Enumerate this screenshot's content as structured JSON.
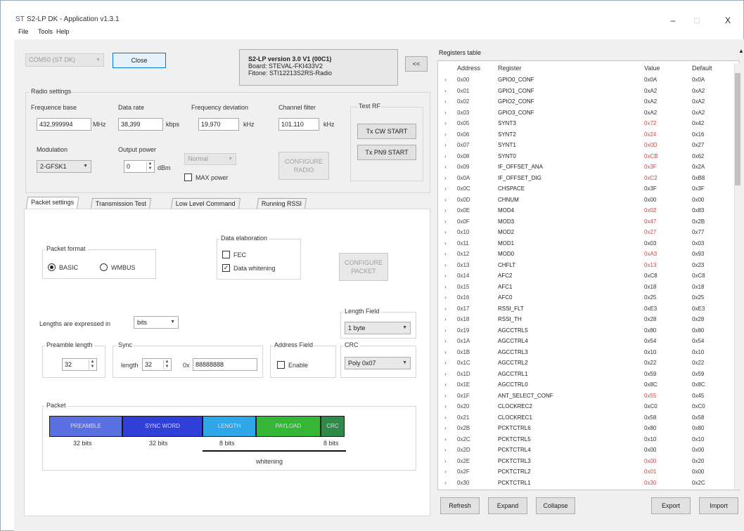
{
  "window": {
    "title": "S2-LP DK - Application v1.3.1",
    "controls": {
      "minimize": "–",
      "maximize": "□",
      "close": "X"
    }
  },
  "menu": {
    "file": "File",
    "tools": "Tools",
    "help": "Help"
  },
  "top": {
    "port_combo": "COM50 (ST DK)",
    "close_button": "Close",
    "device_info": {
      "line1": "S2-LP version 3.0 V1 (00C1)",
      "line2": "Board: STEVAL-FKI433V2",
      "line3": "Fitone: STI12213S2RS-Radio"
    },
    "collapse_button": "<<"
  },
  "radio_settings": {
    "group_title": "Radio settings",
    "frequency_base": {
      "label": "Frequence base",
      "value": "432,999994",
      "unit": "MHz"
    },
    "data_rate": {
      "label": "Data rate",
      "value": "38,399",
      "unit": "kbps"
    },
    "frequency_deviation": {
      "label": "Frequency deviation",
      "value": "19,970",
      "unit": "kHz"
    },
    "channel_filter": {
      "label": "Channel filter",
      "value": "101.110",
      "unit": "kHz"
    },
    "modulation": {
      "label": "Modulation",
      "value": "2-GFSK1"
    },
    "output_power": {
      "label": "Output power",
      "value": "0",
      "unit": "dBm"
    },
    "normal_combo": "Normal",
    "max_power_label": "MAX power",
    "configure_radio": "CONFIGURE RADIO",
    "test_rf": {
      "title": "Test RF",
      "tx_cw": "Tx CW START",
      "tx_pn9": "Tx PN9 START"
    }
  },
  "tabs": [
    {
      "label": "Packet settings"
    },
    {
      "label": "Transmission Test"
    },
    {
      "label": "Low Level Command"
    },
    {
      "label": "Running RSSI"
    }
  ],
  "packet_settings": {
    "packet_format": {
      "title": "Packet format",
      "basic": "BASIC",
      "wmbus": "WMBUS",
      "selected": "BASIC"
    },
    "data_elaboration": {
      "title": "Data elaboration",
      "fec": "FEC",
      "fec_checked": false,
      "whitening": "Data whitening",
      "whitening_checked": true
    },
    "configure_packet": "CONFIGURE PACKET",
    "lengths_label": "Lengths are expressed in",
    "lengths_unit": "bits",
    "length_field": {
      "title": "Length Field",
      "value": "1 byte"
    },
    "preamble": {
      "title": "Preamble length",
      "value": "32"
    },
    "sync": {
      "title": "Sync",
      "length_label": "length",
      "length_value": "32",
      "hex_prefix": "0x",
      "hex_value": "88888888"
    },
    "address_field": {
      "title": "Address Field",
      "enable": "Enable",
      "checked": false
    },
    "crc": {
      "title": "CRC",
      "value": "Poly 0x07"
    },
    "packet": {
      "title": "Packet",
      "segments": [
        {
          "label": "PREAMBLE",
          "bits": "32 bits",
          "color": "#5a6fe0"
        },
        {
          "label": "SYNC WORD",
          "bits": "32 bits",
          "color": "#2f3fd8"
        },
        {
          "label": "LENGTH",
          "bits": "8 bits",
          "color": "#2fa6e8"
        },
        {
          "label": "PAYLOAD",
          "bits": "",
          "color": "#36b636"
        },
        {
          "label": "CRC",
          "bits": "8 bits",
          "color": "#2f8a4a"
        }
      ],
      "whitening_label": "whitening"
    }
  },
  "registers": {
    "title": "Registers table",
    "headers": {
      "address": "Address",
      "register": "Register",
      "value": "Value",
      "default": "Default"
    },
    "rows": [
      {
        "addr": "0x00",
        "name": "GPIO0_CONF",
        "value": "0x0A",
        "default": "0x0A",
        "diff": false
      },
      {
        "addr": "0x01",
        "name": "GPIO1_CONF",
        "value": "0xA2",
        "default": "0xA2",
        "diff": false
      },
      {
        "addr": "0x02",
        "name": "GPIO2_CONF",
        "value": "0xA2",
        "default": "0xA2",
        "diff": false
      },
      {
        "addr": "0x03",
        "name": "GPIO3_CONF",
        "value": "0xA2",
        "default": "0xA2",
        "diff": false
      },
      {
        "addr": "0x05",
        "name": "SYNT3",
        "value": "0x72",
        "default": "0x42",
        "diff": true
      },
      {
        "addr": "0x06",
        "name": "SYNT2",
        "value": "0x24",
        "default": "0x16",
        "diff": true
      },
      {
        "addr": "0x07",
        "name": "SYNT1",
        "value": "0x0D",
        "default": "0x27",
        "diff": true
      },
      {
        "addr": "0x08",
        "name": "SYNT0",
        "value": "0xCB",
        "default": "0x62",
        "diff": true
      },
      {
        "addr": "0x09",
        "name": "IF_OFFSET_ANA",
        "value": "0x3F",
        "default": "0x2A",
        "diff": true
      },
      {
        "addr": "0x0A",
        "name": "IF_OFFSET_DIG",
        "value": "0xC2",
        "default": "0xB8",
        "diff": true
      },
      {
        "addr": "0x0C",
        "name": "CHSPACE",
        "value": "0x3F",
        "default": "0x3F",
        "diff": false
      },
      {
        "addr": "0x0D",
        "name": "CHNUM",
        "value": "0x00",
        "default": "0x00",
        "diff": false
      },
      {
        "addr": "0x0E",
        "name": "MOD4",
        "value": "0x02",
        "default": "0x83",
        "diff": true
      },
      {
        "addr": "0x0F",
        "name": "MOD3",
        "value": "0x47",
        "default": "0x2B",
        "diff": true
      },
      {
        "addr": "0x10",
        "name": "MOD2",
        "value": "0x27",
        "default": "0x77",
        "diff": true
      },
      {
        "addr": "0x11",
        "name": "MOD1",
        "value": "0x03",
        "default": "0x03",
        "diff": false
      },
      {
        "addr": "0x12",
        "name": "MOD0",
        "value": "0xA3",
        "default": "0x93",
        "diff": true
      },
      {
        "addr": "0x13",
        "name": "CHFLT",
        "value": "0x13",
        "default": "0x23",
        "diff": true
      },
      {
        "addr": "0x14",
        "name": "AFC2",
        "value": "0xC8",
        "default": "0xC8",
        "diff": false
      },
      {
        "addr": "0x15",
        "name": "AFC1",
        "value": "0x18",
        "default": "0x18",
        "diff": false
      },
      {
        "addr": "0x16",
        "name": "AFC0",
        "value": "0x25",
        "default": "0x25",
        "diff": false
      },
      {
        "addr": "0x17",
        "name": "RSSI_FLT",
        "value": "0xE3",
        "default": "0xE3",
        "diff": false
      },
      {
        "addr": "0x18",
        "name": "RSSI_TH",
        "value": "0x28",
        "default": "0x28",
        "diff": false
      },
      {
        "addr": "0x19",
        "name": "AGCCTRL5",
        "value": "0x80",
        "default": "0x80",
        "diff": false
      },
      {
        "addr": "0x1A",
        "name": "AGCCTRL4",
        "value": "0x54",
        "default": "0x54",
        "diff": false
      },
      {
        "addr": "0x1B",
        "name": "AGCCTRL3",
        "value": "0x10",
        "default": "0x10",
        "diff": false
      },
      {
        "addr": "0x1C",
        "name": "AGCCTRL2",
        "value": "0x22",
        "default": "0x22",
        "diff": false
      },
      {
        "addr": "0x1D",
        "name": "AGCCTRL1",
        "value": "0x59",
        "default": "0x59",
        "diff": false
      },
      {
        "addr": "0x1E",
        "name": "AGCCTRL0",
        "value": "0x8C",
        "default": "0x8C",
        "diff": false
      },
      {
        "addr": "0x1F",
        "name": "ANT_SELECT_CONF",
        "value": "0x55",
        "default": "0x45",
        "diff": true
      },
      {
        "addr": "0x20",
        "name": "CLOCKREC2",
        "value": "0xC0",
        "default": "0xC0",
        "diff": false
      },
      {
        "addr": "0x21",
        "name": "CLOCKREC1",
        "value": "0x58",
        "default": "0x58",
        "diff": false
      },
      {
        "addr": "0x2B",
        "name": "PCKTCTRL6",
        "value": "0x80",
        "default": "0x80",
        "diff": false
      },
      {
        "addr": "0x2C",
        "name": "PCKTCTRL5",
        "value": "0x10",
        "default": "0x10",
        "diff": false
      },
      {
        "addr": "0x2D",
        "name": "PCKTCTRL4",
        "value": "0x00",
        "default": "0x00",
        "diff": false
      },
      {
        "addr": "0x2E",
        "name": "PCKTCTRL3",
        "value": "0x00",
        "default": "0x20",
        "diff": true
      },
      {
        "addr": "0x2F",
        "name": "PCKTCTRL2",
        "value": "0x01",
        "default": "0x00",
        "diff": true
      },
      {
        "addr": "0x30",
        "name": "PCKTCTRL1",
        "value": "0x30",
        "default": "0x2C",
        "diff": true
      }
    ],
    "buttons": {
      "refresh": "Refresh",
      "expand": "Expand",
      "collapse": "Collapse",
      "export": "Export",
      "import": "Import"
    }
  }
}
